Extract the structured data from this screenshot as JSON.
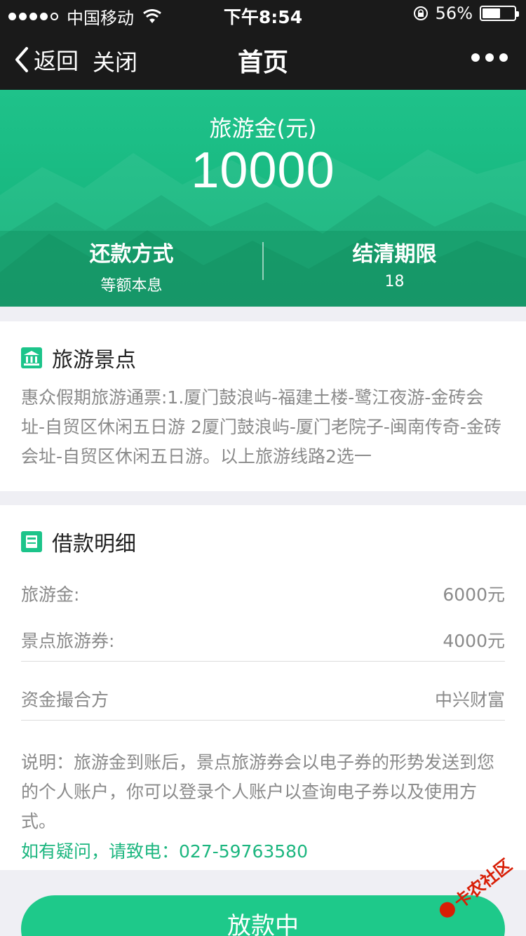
{
  "status_bar": {
    "carrier": "中国移动",
    "time": "下午8:54",
    "battery_percent": "56%",
    "battery_level": 0.56,
    "signal_icon": "signal-dots-icon",
    "wifi_icon": "wifi-icon",
    "lock_icon": "rotation-lock-icon"
  },
  "nav": {
    "back_label": "返回",
    "close_label": "关闭",
    "title": "首页",
    "more_icon": "more-dots-icon"
  },
  "banner": {
    "label": "旅游金(元)",
    "amount": "10000",
    "repayment_title": "还款方式",
    "repayment_value": "等额本息",
    "term_title": "结清期限",
    "term_value": "18"
  },
  "attractions": {
    "title": "旅游景点",
    "icon": "landmark-icon",
    "description": "惠众假期旅游通票:1.厦门鼓浪屿-福建土楼-鹭江夜游-金砖会址-自贸区休闲五日游 2厦门鼓浪屿-厦门老院子-闽南传奇-金砖会址-自贸区休闲五日游。以上旅游线路2选一"
  },
  "details": {
    "title": "借款明细",
    "icon": "card-icon",
    "rows": [
      {
        "label": "旅游金:",
        "value": "6000元"
      },
      {
        "label": "景点旅游券:",
        "value": "4000元"
      },
      {
        "label": "资金撮合方",
        "value": "中兴财富"
      }
    ],
    "note": "说明：旅游金到账后，景点旅游券会以电子券的形势发送到您的个人账户，你可以登录个人账户以查询电子券以及使用方式。",
    "contact": "如有疑问，请致电：027-59763580"
  },
  "action": {
    "button_label": "放款中"
  },
  "watermark": {
    "text": "卡农社区"
  },
  "colors": {
    "accent": "#1cc48a",
    "nav_bg": "#1a1a1a",
    "contact": "#1cb67f"
  }
}
